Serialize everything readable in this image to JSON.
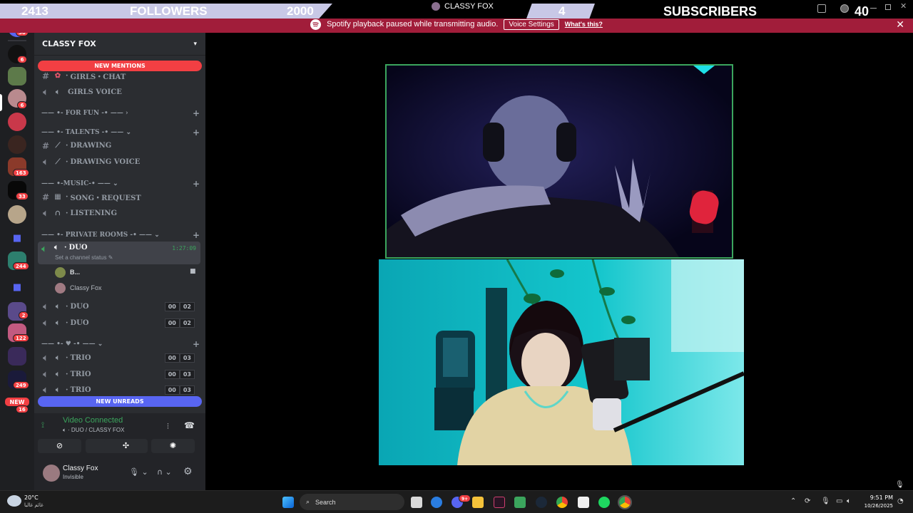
{
  "overlay": {
    "followers_count": "2413",
    "followers_label": "FOLLOWERS",
    "followers_goal": "2000",
    "subscribers_count": "4",
    "subscribers_label": "SUBSCRIBERS",
    "subscribers_goal": "40",
    "window_title": "CLASSY FOX"
  },
  "notice": {
    "text": "Spotify playback paused while transmitting audio.",
    "button": "Voice Settings",
    "link": "What's this?"
  },
  "rail": {
    "badges": [
      "36",
      "6",
      "6",
      "163",
      "33",
      "244",
      "2",
      "122",
      "249",
      "16"
    ],
    "new_label": "NEW"
  },
  "sidebar": {
    "server_name": "CLASSY FOX",
    "new_mentions": "NEW MENTIONS",
    "new_unreads": "NEW UNREADS",
    "channels": [
      {
        "label": "GIRLS・CHAT"
      },
      {
        "label": "GIRLS VOICE"
      },
      {
        "label": "DRAWING"
      },
      {
        "label": "DRAWING VOICE"
      },
      {
        "label": "SONG・REQUEST"
      },
      {
        "label": "LISTENING"
      }
    ],
    "categories": {
      "fun": "—— •- FOR FUN -• ——",
      "talents": "—— •- TALENTS -• ——",
      "music": "—— •-MUSIC-• ——",
      "private": "—— •- PRIVATE ROOMS -• ——",
      "heart": "—— •- ♥ -• ——"
    },
    "active_channel": {
      "label": "DUO",
      "timer": "1:27:09",
      "status": "Set a channel status"
    },
    "members": [
      {
        "name": "B..."
      },
      {
        "name": "Classy Fox"
      }
    ],
    "duo_rooms": [
      {
        "label": "DUO",
        "a": "00",
        "b": "02"
      },
      {
        "label": "DUO",
        "a": "00",
        "b": "02"
      }
    ],
    "trio_rooms": [
      {
        "label": "TRIO",
        "a": "00",
        "b": "03"
      },
      {
        "label": "TRIO",
        "a": "00",
        "b": "03"
      },
      {
        "label": "TRIO",
        "a": "00",
        "b": "03"
      }
    ],
    "voice": {
      "status": "Video Connected",
      "path": "DUO / CLASSY FOX"
    },
    "user": {
      "name": "Classy Fox",
      "status": "Invisible"
    }
  },
  "taskbar": {
    "weather_temp": "20°C",
    "weather_text": "غائم غالبا",
    "search": "Search",
    "time": "9:51 PM",
    "date": "10/26/2025",
    "discord_badge": "9+"
  },
  "colors": {
    "sidebar_bg": "#2b2d31",
    "rail_bg": "#1e1f22",
    "notice_bg": "#a11d3a",
    "mention_red": "#f23f43",
    "unread_blue": "#5865f2",
    "connected_green": "#3ba55d"
  }
}
